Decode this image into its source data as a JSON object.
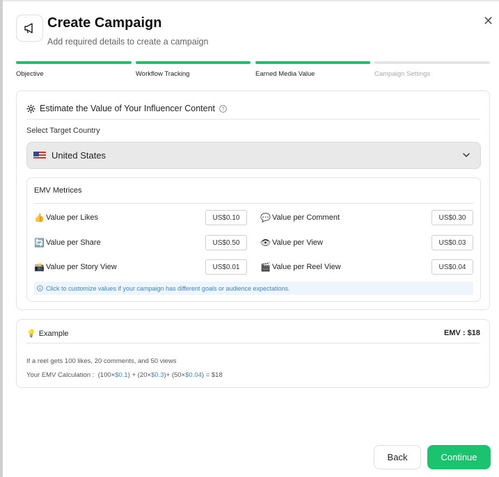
{
  "header": {
    "title": "Create Campaign",
    "subtitle": "Add required details to create a campaign",
    "icon": "megaphone-icon",
    "close_icon": "close-icon"
  },
  "steps": [
    {
      "label": "Objective",
      "state": "done"
    },
    {
      "label": "Workflow Tracking",
      "state": "done"
    },
    {
      "label": "Earned Media Value",
      "state": "done"
    },
    {
      "label": "Campaign Settings",
      "state": "todo"
    }
  ],
  "estimate": {
    "title": "Estimate the Value of Your Influencer Content",
    "country_label": "Select Target Country",
    "country_value": "United States",
    "emv_title": "EMV Metrices",
    "metrics": [
      {
        "label": "Value per Likes",
        "value": "US$0.10",
        "icon": "thumbs-up-icon",
        "emoji": "👍"
      },
      {
        "label": "Value per Comment",
        "value": "US$0.30",
        "icon": "speech-bubble-icon",
        "emoji": "💬"
      },
      {
        "label": "Value per Share",
        "value": "US$0.50",
        "icon": "share-arrows-icon",
        "emoji": "🔄"
      },
      {
        "label": "Value per View",
        "value": "US$0.03",
        "icon": "eye-icon",
        "emoji": "👁"
      },
      {
        "label": "Value per Story View",
        "value": "US$0.01",
        "icon": "camera-flash-icon",
        "emoji": "📸"
      },
      {
        "label": "Value per Reel View",
        "value": "US$0.04",
        "icon": "clapper-board-icon",
        "emoji": "🎬"
      }
    ],
    "info": "Click to customize values if your campaign has different goals or audience expectations."
  },
  "example": {
    "title": "Example",
    "emv": "EMV : $18",
    "line1": "If a reel gets 100 likes, 20 comments, and 50 views",
    "calc_label": "Your EMV Calculation :  ",
    "calc_parts": [
      "(100×",
      "$0.1",
      ") + (20×",
      "$0.3",
      ")+ (50×",
      "$0.04",
      ") = $18"
    ]
  },
  "footer": {
    "back": "Back",
    "continue": "Continue"
  },
  "colors": {
    "accent": "#1bc36f",
    "link": "#3a86c6"
  }
}
